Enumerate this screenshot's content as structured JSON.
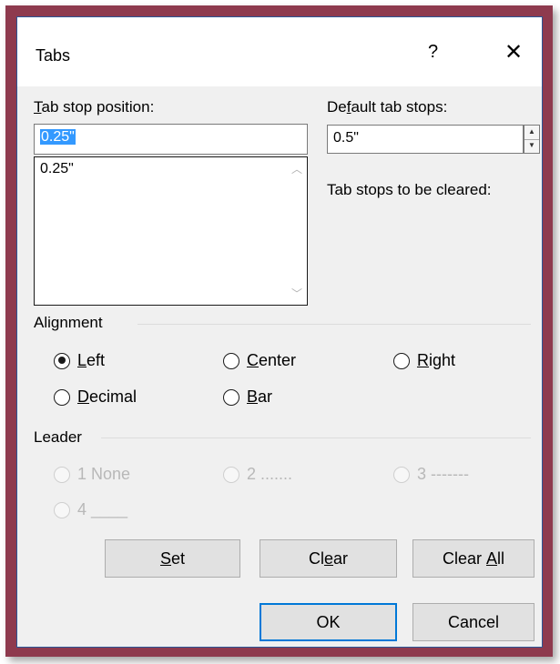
{
  "dialog": {
    "title": "Tabs",
    "help_glyph": "?",
    "close_glyph": "✕"
  },
  "tab_stop_position": {
    "label_prefix_u": "T",
    "label_rest": "ab stop position:",
    "value": "0.25\"",
    "list_items": [
      "0.25\""
    ]
  },
  "default_tab_stops": {
    "label_pre": "De",
    "label_u": "f",
    "label_post": "ault tab stops:",
    "value": "0.5\""
  },
  "tab_stops_to_be_cleared": {
    "label": "Tab stops to be cleared:"
  },
  "alignment": {
    "heading": "Alignment",
    "options": [
      {
        "u": "L",
        "rest": "eft",
        "checked": true
      },
      {
        "u": "C",
        "rest": "enter",
        "checked": false
      },
      {
        "u": "R",
        "rest": "ight",
        "checked": false
      },
      {
        "u": "D",
        "rest": "ecimal",
        "checked": false
      },
      {
        "u": "B",
        "rest": "ar",
        "checked": false
      }
    ]
  },
  "leader": {
    "heading": "Leader",
    "options": [
      "1 None",
      "2 .......",
      "3 -------",
      "4 ____"
    ]
  },
  "buttons": {
    "set": {
      "u": "S",
      "rest": "et"
    },
    "clear": {
      "pre": "Cl",
      "u": "e",
      "post": "ar"
    },
    "clear_all": {
      "pre": "Clear ",
      "u": "A",
      "post": "ll"
    },
    "ok": "OK",
    "cancel": "Cancel"
  },
  "icons": {
    "spin_up": "▲",
    "spin_down": "▼",
    "scroll_up": "︿",
    "scroll_down": "﹀"
  },
  "colors": {
    "frame": "#8e3a4e",
    "selection": "#3399ff",
    "default_button_border": "#0078d7"
  }
}
